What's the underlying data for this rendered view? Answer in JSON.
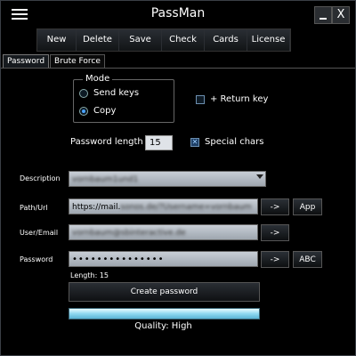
{
  "app": {
    "title": "PassMan"
  },
  "window": {
    "minimize_label": "",
    "close_label": "X"
  },
  "toolbar": {
    "buttons": [
      {
        "label": "New"
      },
      {
        "label": "Delete"
      },
      {
        "label": "Save"
      },
      {
        "label": "Check"
      },
      {
        "label": "Cards"
      },
      {
        "label": "License"
      }
    ]
  },
  "tabs": [
    {
      "label": "Password",
      "active": true
    },
    {
      "label": "Brute Force",
      "active": false
    }
  ],
  "mode": {
    "legend": "Mode",
    "options": [
      {
        "label": "Send keys",
        "selected": false
      },
      {
        "label": "Copy",
        "selected": true
      }
    ]
  },
  "return_key": {
    "label": "+ Return key",
    "checked": false
  },
  "password_length": {
    "label": "Password length",
    "value": "15"
  },
  "special_chars": {
    "label": "Special chars",
    "checked": true
  },
  "fields": {
    "description": {
      "label": "Description",
      "value": "vornbaum1und1"
    },
    "path_url": {
      "label": "Path/Url",
      "value_prefix": "https://mail.",
      "value_blurred": "sonos.de/?Username=vornbaum",
      "arrow": "->",
      "app_button": "App"
    },
    "user_email": {
      "label": "User/Email",
      "value": "vornbaum@sbinteractive.de",
      "arrow": "->"
    },
    "password": {
      "label": "Password",
      "value": "•••••••••••••••",
      "arrow": "->",
      "abc_button": "ABC"
    }
  },
  "length_info": "Length: 15",
  "create_button": "Create password",
  "quality": {
    "text": "Quality: High",
    "level": 1.0
  },
  "colors": {
    "accent": "#4aa3ff",
    "quality_bar": "#8fd8f0"
  }
}
